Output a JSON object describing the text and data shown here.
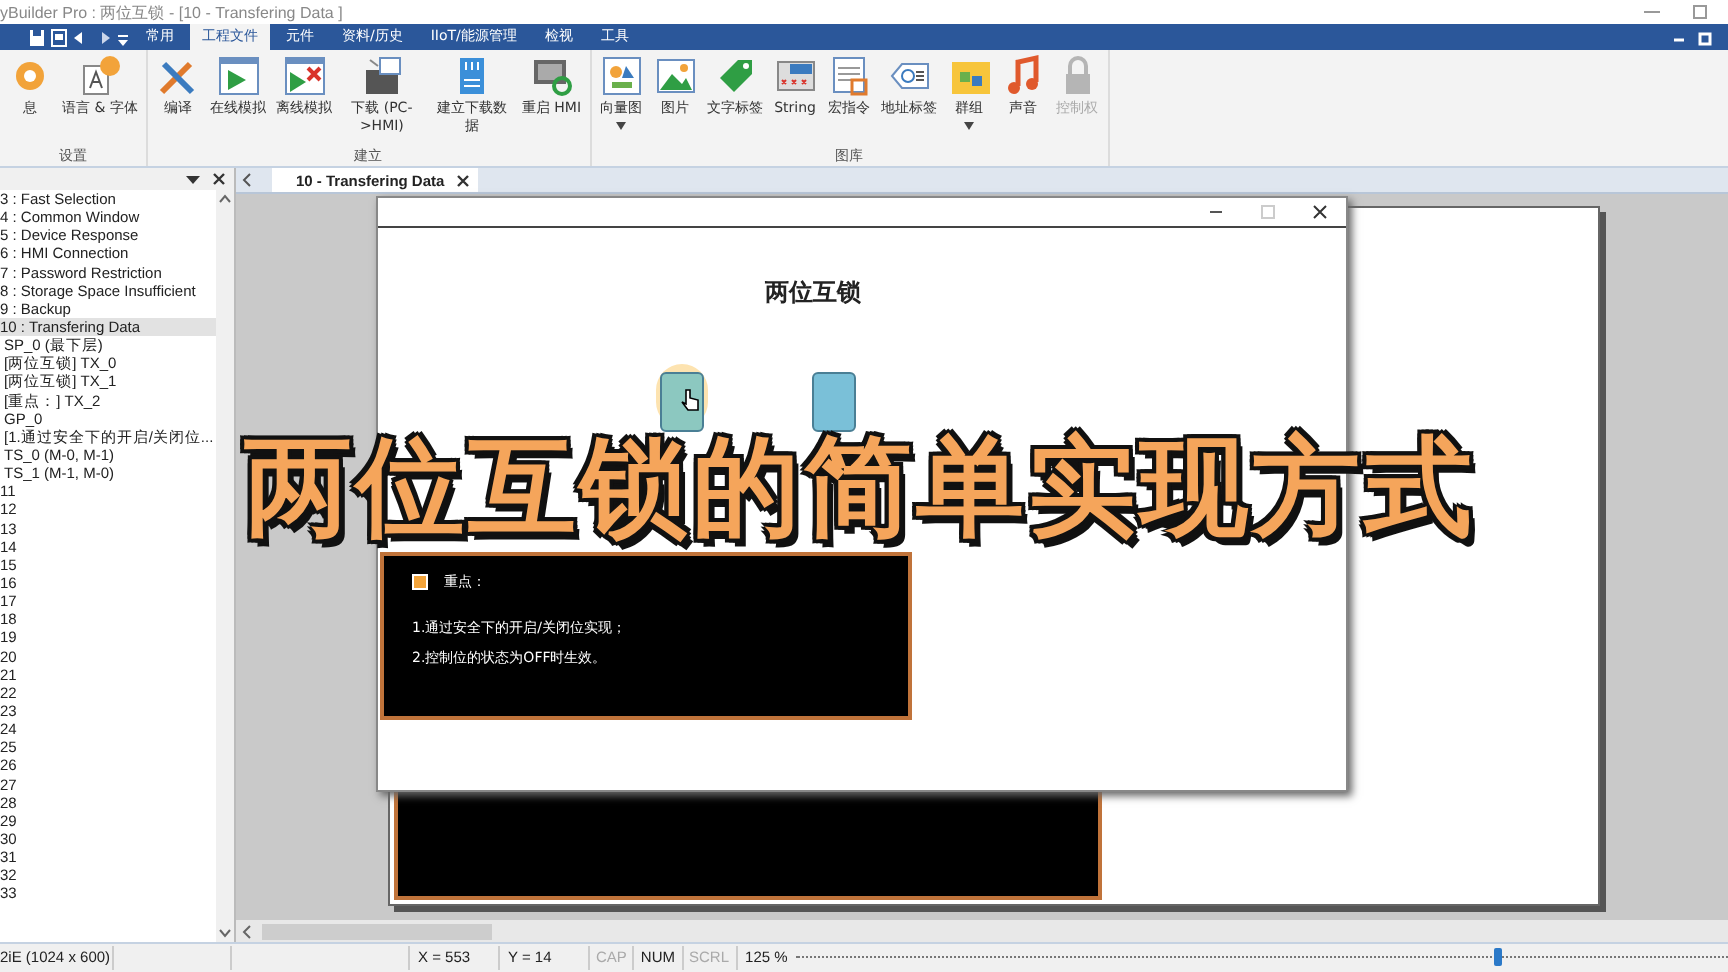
{
  "window": {
    "title": "yBuilder Pro : 两位互锁 - [10 - Transfering Data ]"
  },
  "menu_tabs": [
    {
      "label": "常用",
      "selected": false
    },
    {
      "label": "工程文件",
      "selected": true
    },
    {
      "label": "元件",
      "selected": false
    },
    {
      "label": "资料/历史",
      "selected": false
    },
    {
      "label": "IIoT/能源管理",
      "selected": false
    },
    {
      "label": "检视",
      "selected": false
    },
    {
      "label": "工具",
      "selected": false
    }
  ],
  "ribbon": {
    "groups": [
      {
        "label": "设置",
        "buttons": [
          {
            "label": "息",
            "dropdown": false,
            "disabled": false
          },
          {
            "label": "语言 & 字体",
            "dropdown": false,
            "disabled": false
          }
        ]
      },
      {
        "label": "建立",
        "buttons": [
          {
            "label": "编译",
            "dropdown": false,
            "disabled": false
          },
          {
            "label": "在线模拟",
            "dropdown": false,
            "disabled": false
          },
          {
            "label": "离线模拟",
            "dropdown": false,
            "disabled": false
          },
          {
            "label": "下载 (PC->HMI)",
            "dropdown": false,
            "disabled": false
          },
          {
            "label": "建立下载数据",
            "dropdown": false,
            "disabled": false
          },
          {
            "label": "重启 HMI",
            "dropdown": false,
            "disabled": false
          }
        ]
      },
      {
        "label": "图库",
        "buttons": [
          {
            "label": "向量图",
            "dropdown": true,
            "disabled": false
          },
          {
            "label": "图片",
            "dropdown": false,
            "disabled": false
          },
          {
            "label": "文字标签",
            "dropdown": false,
            "disabled": false
          },
          {
            "label": "String",
            "dropdown": false,
            "disabled": false
          },
          {
            "label": "宏指令",
            "dropdown": false,
            "disabled": false
          },
          {
            "label": "地址标签",
            "dropdown": false,
            "disabled": false
          },
          {
            "label": "群组",
            "dropdown": true,
            "disabled": false
          },
          {
            "label": "声音",
            "dropdown": false,
            "disabled": false
          },
          {
            "label": "控制权",
            "dropdown": false,
            "disabled": true
          }
        ]
      }
    ]
  },
  "tree": {
    "items": [
      {
        "label": "3 : Fast Selection",
        "selected": false
      },
      {
        "label": "4 : Common Window",
        "selected": false
      },
      {
        "label": "5 : Device Response",
        "selected": false
      },
      {
        "label": "6 : HMI Connection",
        "selected": false
      },
      {
        "label": "7 : Password Restriction",
        "selected": false
      },
      {
        "label": "8 : Storage Space Insufficient",
        "selected": false
      },
      {
        "label": "9 : Backup",
        "selected": false
      },
      {
        "label": "10 : Transfering Data",
        "selected": true,
        "children": [
          {
            "label": "SP_0 (最下层)",
            "selected": false
          },
          {
            "label": "[两位互锁] TX_0",
            "selected": false
          },
          {
            "label": "[两位互锁] TX_1",
            "selected": false
          },
          {
            "label": "[重点：] TX_2",
            "selected": false
          },
          {
            "label": "GP_0",
            "selected": false
          },
          {
            "label": "[1.通过安全下的开启/关闭位...",
            "selected": false
          },
          {
            "label": "TS_0 (M-0, M-1)",
            "selected": false
          },
          {
            "label": "TS_1 (M-1, M-0)",
            "selected": false
          }
        ]
      },
      {
        "label": "11",
        "selected": false
      },
      {
        "label": "12",
        "selected": false
      },
      {
        "label": "13",
        "selected": false
      },
      {
        "label": "14",
        "selected": false
      },
      {
        "label": "15",
        "selected": false
      },
      {
        "label": "16",
        "selected": false
      },
      {
        "label": "17",
        "selected": false
      },
      {
        "label": "18",
        "selected": false
      },
      {
        "label": "19",
        "selected": false
      },
      {
        "label": "20",
        "selected": false
      },
      {
        "label": "21",
        "selected": false
      },
      {
        "label": "22",
        "selected": false
      },
      {
        "label": "23",
        "selected": false
      },
      {
        "label": "24",
        "selected": false
      },
      {
        "label": "25",
        "selected": false
      },
      {
        "label": "26",
        "selected": false
      },
      {
        "label": "27",
        "selected": false
      },
      {
        "label": "28",
        "selected": false
      },
      {
        "label": "29",
        "selected": false
      },
      {
        "label": "30",
        "selected": false
      },
      {
        "label": "31",
        "selected": false
      },
      {
        "label": "32",
        "selected": false
      },
      {
        "label": "33",
        "selected": false
      }
    ]
  },
  "document_tabs": [
    {
      "label": "10 - Transfering Data",
      "selected": true
    }
  ],
  "screen": {
    "title": "两位互锁",
    "toggles": [
      {
        "highlighted": true
      },
      {
        "highlighted": false
      }
    ],
    "note": {
      "heading": "重点：",
      "lines": [
        "1.通过安全下的开启/关闭位实现；",
        "2.控制位的状态为OFF时生效。"
      ]
    }
  },
  "caption": "两位互锁的简单实现方式",
  "status_bar": {
    "model": "2iE (1024 x 600)",
    "x": "X = 553",
    "y": "Y = 14",
    "indicators": [
      {
        "label": "CAP",
        "disabled": true
      },
      {
        "label": "NUM",
        "disabled": false
      },
      {
        "label": "SCRL",
        "disabled": true
      }
    ],
    "zoom": "125 %",
    "zoom_slider": {
      "level": 0.75
    }
  }
}
